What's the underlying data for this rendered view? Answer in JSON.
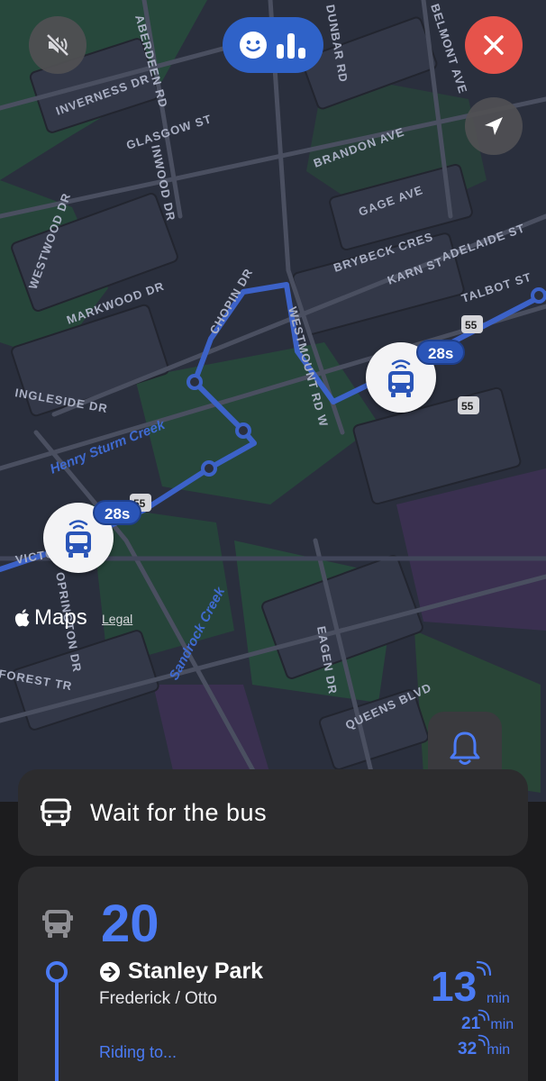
{
  "map": {
    "street_labels": [
      "DUNBAR RD",
      "BELMONT AVE",
      "ABERDEEN RD",
      "INVERNESS DR",
      "GLASGOW ST",
      "INWOOD DR",
      "BRANDON AVE",
      "GAGE AVE",
      "WESTWOOD DR",
      "BRYBECK CRES",
      "KARN ST",
      "ADELAIDE ST",
      "TALBOT ST",
      "MARKWOOD DR",
      "CHOPIN DR",
      "WESTMOUNT RD W",
      "INGLESIDE DR",
      "Henry Sturm Creek",
      "Sandrock Creek",
      "EAGEN DR",
      "QUEENS BLVD",
      "FOREST TR",
      "OPRINGTON DR",
      "VICTORIA ST"
    ],
    "highway_shields": [
      "55",
      "55",
      "55"
    ],
    "buses": [
      {
        "eta": "28s"
      },
      {
        "eta": "28s"
      }
    ],
    "attribution": {
      "logo": "Maps",
      "legal": "Legal"
    }
  },
  "controls": {
    "mute": "speaker-muted-icon",
    "feedback": "feedback-icon",
    "close": "close-icon",
    "locate": "location-arrow-icon",
    "alert": "bell-icon"
  },
  "wait_card": {
    "text": "Wait for the bus"
  },
  "route_card": {
    "route_number": "20",
    "destination": "Stanley Park",
    "stop": "Frederick / Otto",
    "riding_to": "Riding to...",
    "arrivals": [
      {
        "value": "13",
        "unit": "min"
      },
      {
        "value": "21",
        "unit": "min"
      },
      {
        "value": "32",
        "unit": "min"
      }
    ]
  },
  "colors": {
    "accent": "#4b7bf5",
    "close": "#e6534b",
    "map_bg": "#2a2f3d",
    "route_line": "#3c62c8"
  }
}
